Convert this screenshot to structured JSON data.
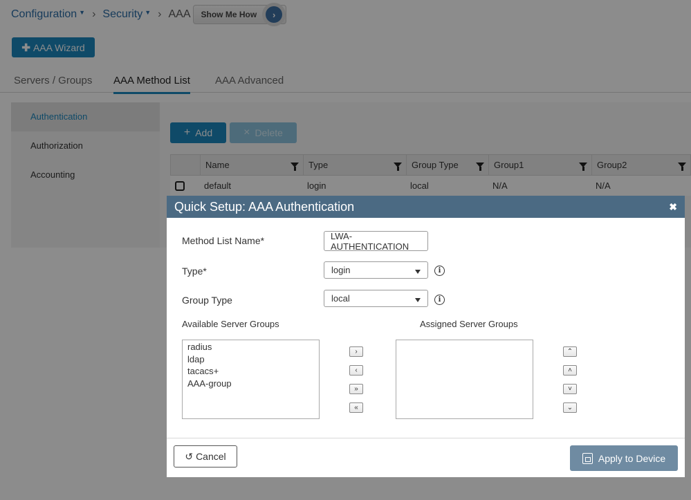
{
  "breadcrumb": {
    "items": [
      "Configuration",
      "Security"
    ],
    "current": "AAA",
    "show_me_how": "Show Me How"
  },
  "toolbar": {
    "wizard_label": "AAA Wizard"
  },
  "tabs": [
    {
      "label": "Servers / Groups",
      "active": false
    },
    {
      "label": "AAA Method List",
      "active": true
    },
    {
      "label": "AAA Advanced",
      "active": false
    }
  ],
  "sidebar": {
    "items": [
      {
        "label": "Authentication",
        "active": true
      },
      {
        "label": "Authorization",
        "active": false
      },
      {
        "label": "Accounting",
        "active": false
      }
    ]
  },
  "actions": {
    "add_label": "Add",
    "delete_label": "Delete"
  },
  "table": {
    "columns": [
      "Name",
      "Type",
      "Group Type",
      "Group1",
      "Group2"
    ],
    "rows": [
      {
        "name": "default",
        "type": "login",
        "group_type": "local",
        "group1": "N/A",
        "group2": "N/A"
      }
    ]
  },
  "modal": {
    "title": "Quick Setup: AAA Authentication",
    "method_list_label": "Method List Name*",
    "method_list_value": "LWA-AUTHENTICATION",
    "type_label": "Type*",
    "type_value": "login",
    "group_type_label": "Group Type",
    "group_type_value": "local",
    "available_label": "Available Server Groups",
    "assigned_label": "Assigned Server Groups",
    "available_groups": [
      "radius",
      "ldap",
      "tacacs+",
      "AAA-group"
    ],
    "assigned_groups": [],
    "cancel_label": "Cancel",
    "apply_label": "Apply to Device"
  },
  "colors": {
    "accent": "#1d87be",
    "modal_header": "#4b6a83",
    "apply_button": "#6f8ba2"
  }
}
